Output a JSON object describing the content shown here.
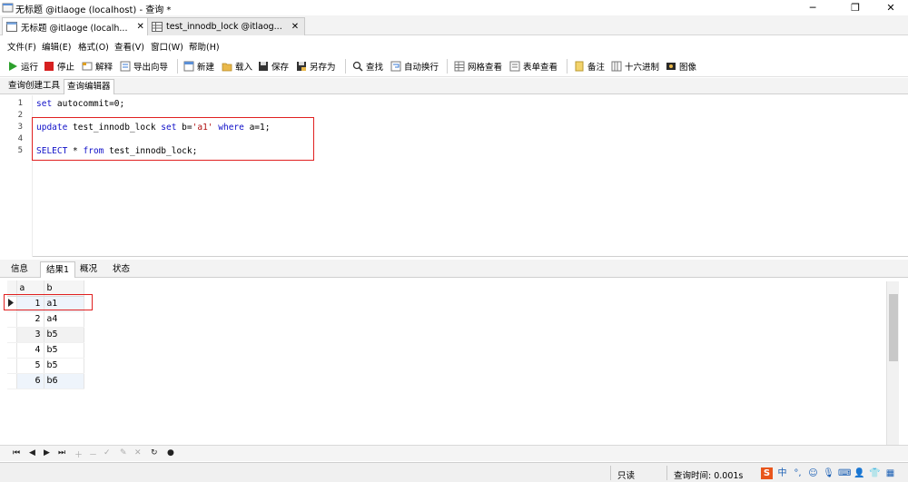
{
  "window": {
    "title": "无标题 @itlaoge (localhost) - 查询 *",
    "minimize": "─",
    "maximize": "❐",
    "close": "✕"
  },
  "doc_tabs": [
    {
      "label": "无标题 @itlaoge (localh...",
      "close": "✕"
    },
    {
      "label": "test_innodb_lock @itlaog...",
      "close": "✕"
    }
  ],
  "menu": [
    "文件(F)",
    "编辑(E)",
    "格式(O)",
    "查看(V)",
    "窗口(W)",
    "帮助(H)"
  ],
  "toolbar": {
    "run": "运行",
    "stop": "停止",
    "explain": "解释",
    "export_wizard": "导出向导",
    "new": "新建",
    "load": "载入",
    "save": "保存",
    "save_as": "另存为",
    "find": "查找",
    "wrap": "自动换行",
    "grid_view": "网格查看",
    "form_view": "表单查看",
    "memo": "备注",
    "hex": "十六进制",
    "image": "图像"
  },
  "sub_tabs": [
    "查询创建工具",
    "查询编辑器"
  ],
  "editor": {
    "line_numbers": [
      "1",
      "2",
      "3",
      "4",
      "5"
    ],
    "lines": {
      "l1": {
        "kw": "set",
        "rest": " autocommit=0;"
      },
      "l3": {
        "kw1": "update",
        "t1": " test_innodb_lock ",
        "kw2": "set",
        "t2": " b=",
        "str": "'a1'",
        "t3": " ",
        "kw3": "where",
        "t4": " a=1;"
      },
      "l5": {
        "kw1": "SELECT",
        "t1": " * ",
        "kw2": "from",
        "t2": " test_innodb_lock;"
      }
    }
  },
  "result_tabs": [
    "信息",
    "结果1",
    "概况",
    "状态"
  ],
  "grid": {
    "columns": [
      "a",
      "b"
    ],
    "rows": [
      {
        "a": "1",
        "b": "a1"
      },
      {
        "a": "2",
        "b": "a4"
      },
      {
        "a": "3",
        "b": "b5"
      },
      {
        "a": "4",
        "b": "b5"
      },
      {
        "a": "5",
        "b": "b5"
      },
      {
        "a": "6",
        "b": "b6"
      }
    ]
  },
  "status": {
    "mode": "只读",
    "query_time": "查询时间: 0.001s"
  },
  "ime": {
    "lang": "中"
  },
  "colors": {
    "accent_red": "#e02020",
    "keyword": "#1010c8"
  }
}
